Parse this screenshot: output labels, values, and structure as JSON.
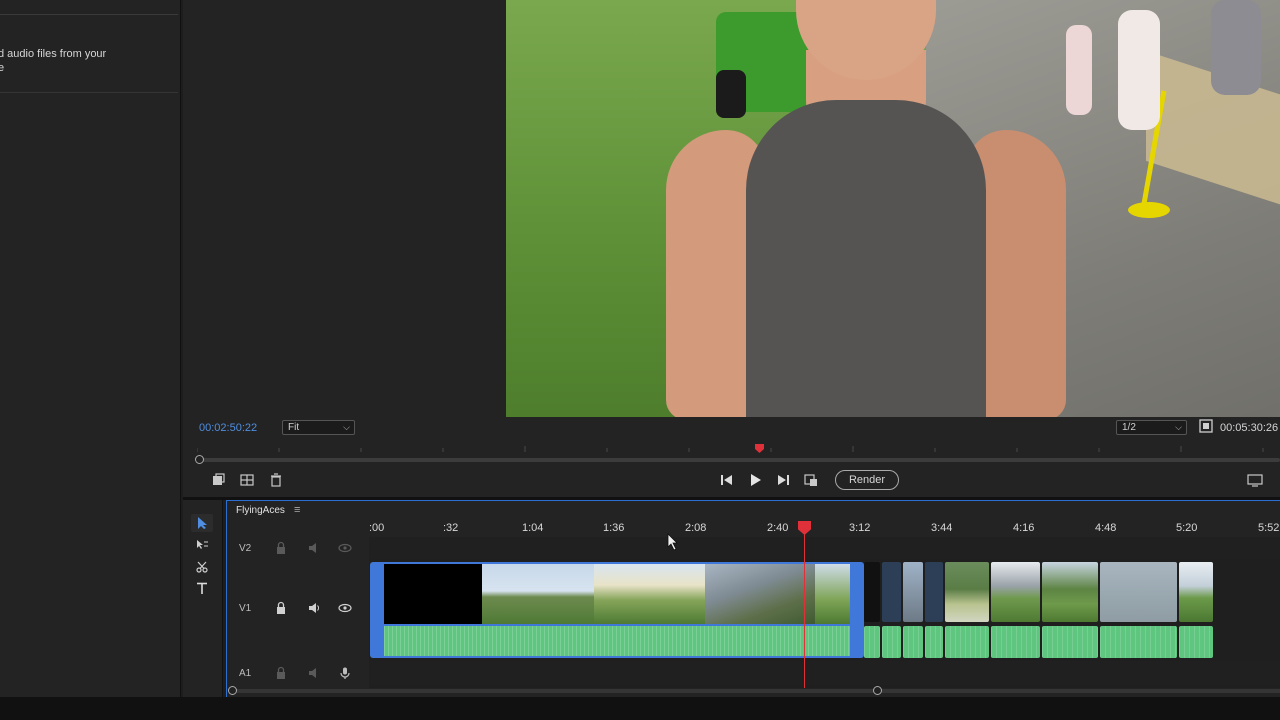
{
  "project_panel": {
    "import_hint_line1": "d audio files from your",
    "import_hint_line2": "e"
  },
  "monitor": {
    "timecode_current": "00:02:50:22",
    "zoom_select": "Fit",
    "resolution_select": "1/2",
    "timecode_duration": "00:05:30:26",
    "render_label": "Render"
  },
  "timeline": {
    "sequence_name": "FlyingAces",
    "ruler_ticks": [
      ":00",
      ":32",
      "1:04",
      "1:36",
      "2:08",
      "2:40",
      "3:12",
      "3:44",
      "4:16",
      "4:48",
      "5:20",
      "5:52"
    ],
    "tracks": [
      {
        "label": "V2"
      },
      {
        "label": "V1"
      },
      {
        "label": "A1"
      }
    ]
  },
  "colors": {
    "accent": "#2b6fd2",
    "timecode": "#4f8ee0",
    "playhead": "#e0303a",
    "audio_clip": "#5fc680",
    "selected_clip": "#3f78d8"
  }
}
